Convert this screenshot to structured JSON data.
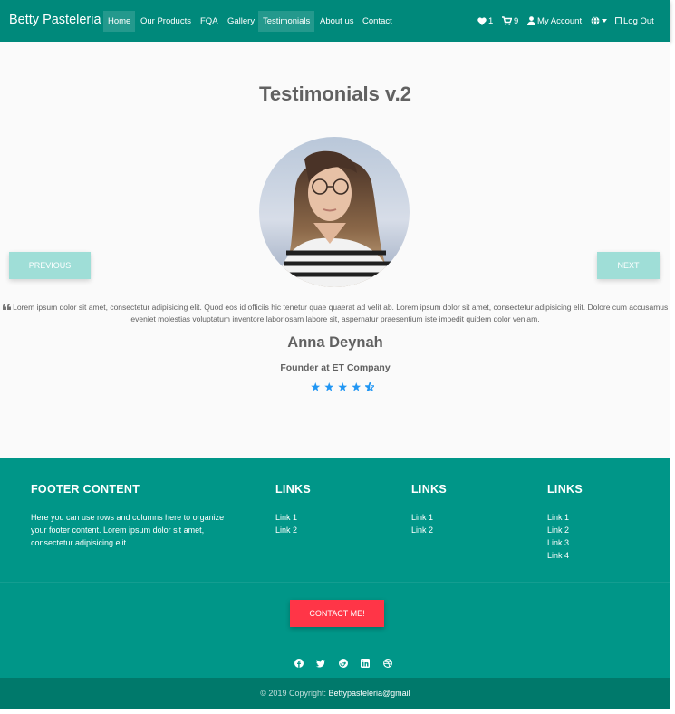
{
  "nav": {
    "brand": "Betty Pasteleria",
    "links": [
      "Home",
      "Our Products",
      "FQA",
      "Gallery",
      "Testimonials",
      "About us",
      "Contact"
    ],
    "favorites_count": "1",
    "cart_count": "9",
    "account_label": "My Account",
    "logout_label": "Log Out"
  },
  "testimonial": {
    "title": "Testimonials v.2",
    "prev_label": "PREVIOUS",
    "next_label": "NEXT",
    "quote": "Lorem ipsum dolor sit amet, consectetur adipisicing elit. Quod eos id officiis hic tenetur quae quaerat ad velit ab. Lorem ipsum dolor sit amet, consectetur adipisicing elit. Dolore cum accusamus eveniet molestias voluptatum inventore laboriosam labore sit, aspernatur praesentium iste impedit quidem dolor veniam.",
    "name": "Anna Deynah",
    "role": "Founder at ET Company",
    "rating": 4.5,
    "star_color": "#2196f3"
  },
  "footer": {
    "content_heading": "FOOTER CONTENT",
    "content_text": "Here you can use rows and columns here to organize your footer content. Lorem ipsum dolor sit amet, consectetur adipisicing elit.",
    "columns": [
      {
        "heading": "LINKS",
        "links": [
          "Link 1",
          "Link 2"
        ]
      },
      {
        "heading": "LINKS",
        "links": [
          "Link 1",
          "Link 2"
        ]
      },
      {
        "heading": "LINKS",
        "links": [
          "Link 1",
          "Link 2",
          "Link 3",
          "Link 4"
        ]
      }
    ],
    "contact_button": "CONTACT ME!",
    "social_icons": [
      "facebook-icon",
      "twitter-icon",
      "google-plus-icon",
      "linkedin-icon",
      "dribbble-icon"
    ],
    "copyright_prefix": "© 2019 Copyright:",
    "copyright_link": "Bettypasteleria@gmail"
  },
  "colors": {
    "navbar": "#00897b",
    "footer": "#009688",
    "copybar": "#00796b",
    "carousel_button": "#9fded7",
    "contact_button": "#ff3547"
  }
}
